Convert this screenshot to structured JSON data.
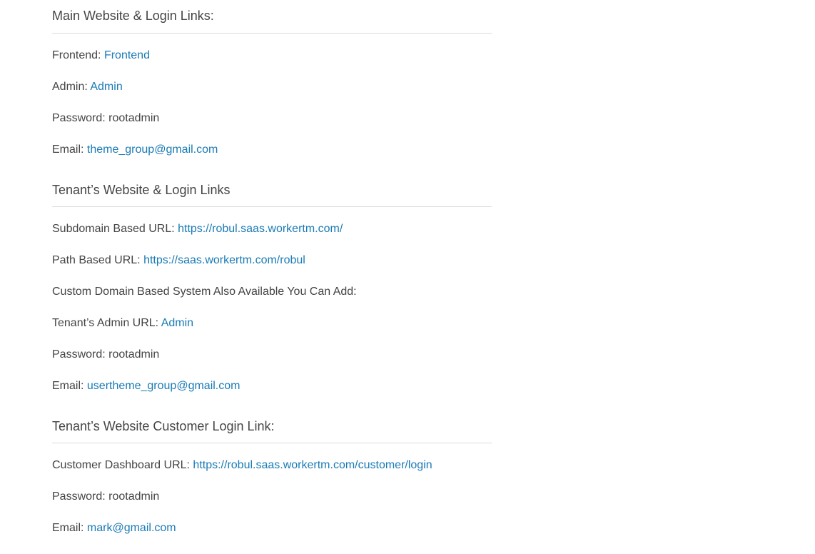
{
  "sections": [
    {
      "heading": "Main Website & Login Links:",
      "lines": [
        {
          "label": "Frontend:",
          "link": "Frontend"
        },
        {
          "label": "Admin:",
          "link": "Admin"
        },
        {
          "label": "Password: rootadmin"
        },
        {
          "label": "Email:",
          "link": "theme_group@gmail.com"
        }
      ]
    },
    {
      "heading": "Tenant’s Website & Login Links",
      "lines": [
        {
          "label": "Subdomain Based URL:",
          "link": "https://robul.saas.workertm.com/"
        },
        {
          "label": "Path Based URL:",
          "link": "https://saas.workertm.com/robul"
        },
        {
          "label": "Custom Domain Based System Also Available You Can Add:"
        },
        {
          "label": "Tenant’s Admin URL:",
          "link": "Admin"
        },
        {
          "label": "Password: rootadmin"
        },
        {
          "label": "Email:",
          "link": "usertheme_group@gmail.com"
        }
      ]
    },
    {
      "heading": "Tenant’s Website Customer Login Link:",
      "lines": [
        {
          "label": "Customer Dashboard URL:",
          "link": "https://robul.saas.workertm.com/customer/login"
        },
        {
          "label": "Password: rootadmin"
        },
        {
          "label": "Email:",
          "link": "mark@gmail.com"
        }
      ]
    }
  ],
  "colors": {
    "text": "#444444",
    "link": "#1a7bb5",
    "rule": "#dddddd"
  }
}
